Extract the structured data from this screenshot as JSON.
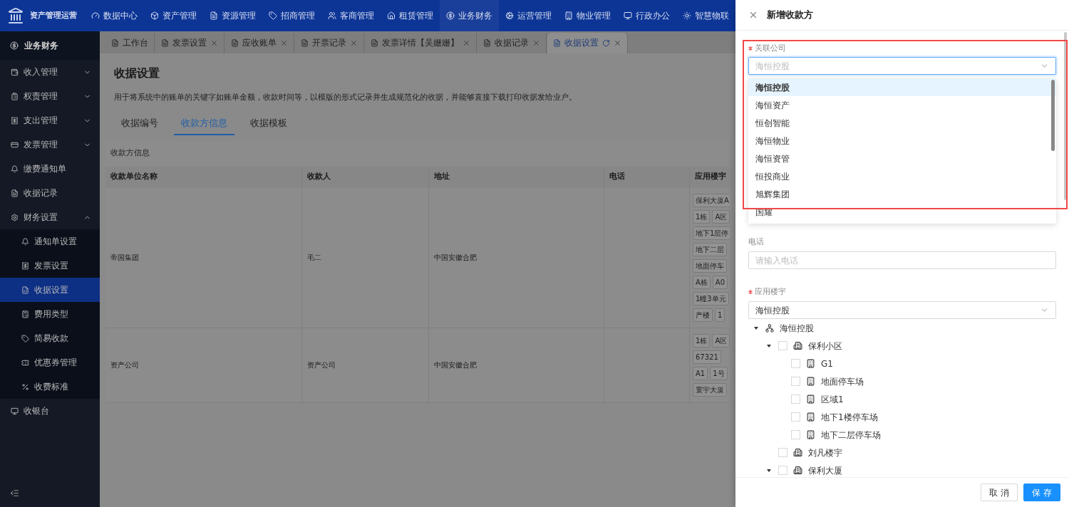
{
  "app": {
    "title": "资产管理运营"
  },
  "top_nav": [
    {
      "label": "数据中心",
      "selected": false
    },
    {
      "label": "资产管理",
      "selected": false
    },
    {
      "label": "资源管理",
      "selected": false
    },
    {
      "label": "招商管理",
      "selected": false
    },
    {
      "label": "客商管理",
      "selected": false
    },
    {
      "label": "租赁管理",
      "selected": false
    },
    {
      "label": "业务财务",
      "selected": true
    },
    {
      "label": "运营管理",
      "selected": false
    },
    {
      "label": "物业管理",
      "selected": false
    },
    {
      "label": "行政办公",
      "selected": false
    },
    {
      "label": "智慧物联",
      "selected": false
    }
  ],
  "sidebar": {
    "title": "业务财务",
    "items": [
      {
        "label": "收入管理",
        "expanded": false,
        "selected": false
      },
      {
        "label": "权责管理",
        "expanded": false,
        "selected": false
      },
      {
        "label": "支出管理",
        "expanded": false,
        "selected": false
      },
      {
        "label": "发票管理",
        "expanded": false,
        "selected": false
      },
      {
        "label": "缴费通知单",
        "selected": false
      },
      {
        "label": "收据记录",
        "selected": false
      },
      {
        "label": "财务设置",
        "expanded": true,
        "selected": false,
        "children": [
          {
            "label": "通知单设置",
            "selected": false
          },
          {
            "label": "发票设置",
            "selected": false
          },
          {
            "label": "收据设置",
            "selected": true
          },
          {
            "label": "费用类型",
            "selected": false
          },
          {
            "label": "简易收款",
            "selected": false
          },
          {
            "label": "优惠券管理",
            "selected": false
          },
          {
            "label": "收费标准",
            "selected": false
          }
        ]
      },
      {
        "label": "收银台",
        "selected": false
      }
    ]
  },
  "open_tabs": [
    {
      "label": "工作台",
      "selected": false,
      "closable": false
    },
    {
      "label": "发票设置",
      "selected": false,
      "closable": true
    },
    {
      "label": "应收账单",
      "selected": false,
      "closable": true
    },
    {
      "label": "开票记录",
      "selected": false,
      "closable": true
    },
    {
      "label": "发票详情【吴姗姗】",
      "selected": false,
      "closable": true
    },
    {
      "label": "收据记录",
      "selected": false,
      "closable": true
    },
    {
      "label": "收据设置",
      "selected": true,
      "closable": true
    }
  ],
  "page": {
    "title": "收据设置",
    "description": "用于将系统中的账单的关键字如账单金额，收款时间等，以模版的形式记录并生成规范化的收据，并能够直接下载打印收据发给业户。",
    "tabs": [
      {
        "label": "收据编号",
        "selected": false
      },
      {
        "label": "收款方信息",
        "selected": true
      },
      {
        "label": "收据模板",
        "selected": false
      }
    ],
    "card_title": "收款方信息",
    "table": {
      "columns": [
        "收款单位名称",
        "收款人",
        "地址",
        "电话",
        "应用楼宇"
      ],
      "rows": [
        {
          "name": "帝国集团",
          "payee": "毛二",
          "address": "中国安徽合肥",
          "building_tags": [
            [
              "保利大厦A"
            ],
            [
              "1栋",
              "A区"
            ],
            [
              "地下1层停"
            ],
            [
              "地下二层"
            ],
            [
              "地面停车"
            ],
            [
              "A栋",
              "A0"
            ],
            [
              "1幢3单元"
            ],
            [
              "产楼",
              "1"
            ]
          ]
        },
        {
          "name": "资产公司",
          "payee": "资产公司",
          "address": "中国安徽合肥",
          "building_tags": [
            [
              "1栋",
              "A区"
            ],
            [
              "67321"
            ],
            [
              "A1",
              "1号"
            ],
            [
              "寰宇大厦"
            ]
          ]
        }
      ]
    }
  },
  "drawer": {
    "title": "新增收款方",
    "company": {
      "label": "关联公司",
      "required": true,
      "placeholder": "海恒控股",
      "focused": true,
      "options": [
        {
          "label": "海恒控股",
          "selected": true
        },
        {
          "label": "海恒资产",
          "selected": false
        },
        {
          "label": "恒创智能",
          "selected": false
        },
        {
          "label": "海恒物业",
          "selected": false
        },
        {
          "label": "海恒资管",
          "selected": false
        },
        {
          "label": "恒投商业",
          "selected": false
        },
        {
          "label": "旭辉集团",
          "selected": false
        },
        {
          "label": "国耀",
          "selected": false
        }
      ]
    },
    "phone": {
      "label": "电话",
      "placeholder": "请输入电话"
    },
    "buildings": {
      "label": "应用楼宇",
      "required": true,
      "value": "海恒控股",
      "tree": [
        {
          "label": "海恒控股",
          "kind": "org",
          "expanded": true,
          "children": [
            {
              "label": "保利小区",
              "kind": "estate",
              "expanded": true,
              "checked": false,
              "children": [
                {
                  "label": "G1",
                  "kind": "building",
                  "checked": false
                },
                {
                  "label": "地面停车场",
                  "kind": "building",
                  "checked": false
                },
                {
                  "label": "区域1",
                  "kind": "building",
                  "checked": false
                },
                {
                  "label": "地下1楼停车场",
                  "kind": "building",
                  "checked": false
                },
                {
                  "label": "地下二层停车场",
                  "kind": "building",
                  "checked": false
                }
              ]
            },
            {
              "label": "刘凡楼宇",
              "kind": "estate",
              "checked": false
            },
            {
              "label": "保利大厦",
              "kind": "estate",
              "expanded": true,
              "checked": false
            }
          ]
        }
      ]
    },
    "buttons": [
      {
        "label": "取 消",
        "kind": "secondary"
      },
      {
        "label": "保 存",
        "kind": "primary"
      }
    ]
  }
}
